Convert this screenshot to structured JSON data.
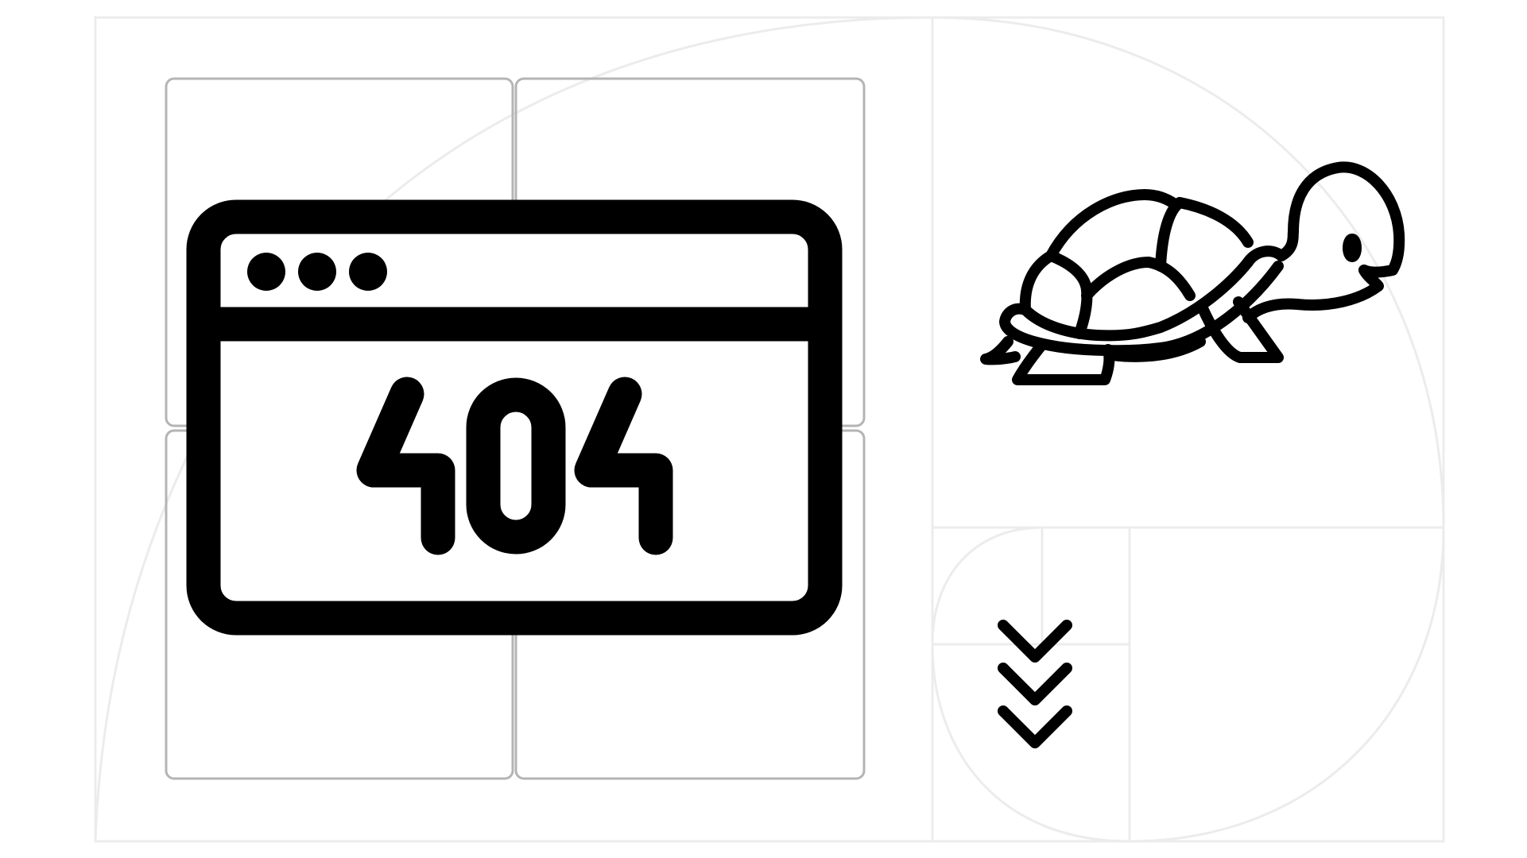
{
  "error_code_digits": [
    "4",
    "0",
    "4"
  ],
  "colors": {
    "accent": "#0b9039",
    "ink": "#000000",
    "tile_border": "#b4b4b4",
    "guide": "#ececec",
    "background": "#ffffff"
  },
  "icons": {
    "browser": "browser-window-404-icon",
    "turtle": "turtle-icon",
    "chevrons": "triple-chevron-down-icon"
  }
}
